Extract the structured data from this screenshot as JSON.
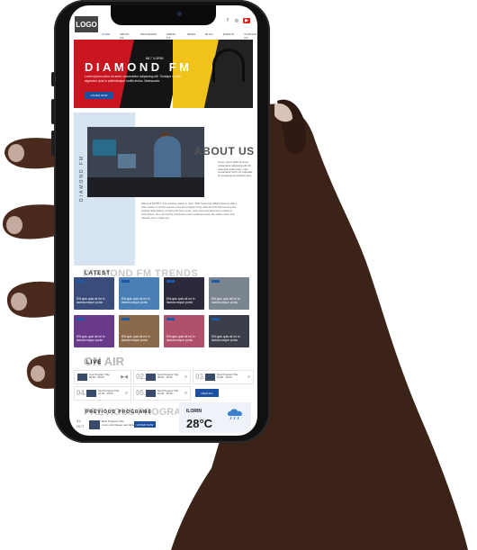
{
  "header": {
    "logo": "LOGO",
    "nav": [
      "HOME",
      "ABOUT US",
      "PROGRAMS",
      "PRESS KIT",
      "NEWS",
      "BLOG",
      "EVENTS",
      "CONTACT US"
    ],
    "socials": [
      "f",
      "◎",
      "▶"
    ]
  },
  "hero": {
    "tagline": "88.7 ILORIN",
    "title": "DIAMOND FM",
    "description": "Lorem ipsum dolor sit amet, consectetur adipiscing elit. Tristique in quis dignissim quis in pellentesque mollis lectus. Malesuada.",
    "button": "LISTEN NOW"
  },
  "about": {
    "vertical_label": "DIAMOND FM",
    "title": "ABOUT US",
    "aside": "Lorem ipsum dolor sit amet, consectetur adipiscing elit. Mi vitae quis dolor tortor, nulla consectetur tortor. Ac vulputate at consequat ac tincidunt arcu.",
    "paragraph": "Diamond FM 88.7 is an exciting station in Ilorin. With hosts that delight listeners with a wide variety of content across news and programming. Diamond FM has become the leading radio station, bringing the best music, news and entertainment to listeners everywhere. Our community, presenters and contributors keep the station fresh and relevant every single day."
  },
  "trends": {
    "heading_big": "DIAMOND FM TRENDS",
    "heading_small": "LATEST",
    "cards": [
      {
        "text": "Elit quis quis sit mi in lacinia neque porta",
        "color": "#3a4d7a"
      },
      {
        "text": "Elit quis quis sit mi in lacinia neque porta",
        "color": "#4a7fb5"
      },
      {
        "text": "Elit quis quis sit mi in lacinia neque porta",
        "color": "#2a2a3a"
      },
      {
        "text": "Elit quis quis sit mi in lacinia neque porta",
        "color": "#7a8590"
      },
      {
        "text": "Elit quis quis sit mi in lacinia neque porta",
        "color": "#6a3a8a"
      },
      {
        "text": "Elit quis quis sit mi in lacinia neque porta",
        "color": "#8a6a4a"
      },
      {
        "text": "Elit quis quis sit mi in lacinia neque porta",
        "color": "#b0506a"
      },
      {
        "text": "Elit quis quis sit mi in lacinia neque porta",
        "color": "#3a3f4a"
      }
    ]
  },
  "onair": {
    "heading_big": "ON AIR",
    "heading_small": "LIVE",
    "items": [
      {
        "num": "",
        "line1": "Live Program Title",
        "line2": "06:00 - 08:00"
      },
      {
        "num": "02.",
        "line1": "Next Program Title",
        "line2": "08:00 - 10:00"
      },
      {
        "num": "03.",
        "line1": "Next Program Title",
        "line2": "10:00 - 12:00"
      },
      {
        "num": "04.",
        "line1": "Next Program Title",
        "line2": "12:00 - 14:00"
      },
      {
        "num": "05.",
        "line1": "Next Program Title",
        "line2": "14:00 - 16:00"
      }
    ],
    "view_all": "VIEW ALL"
  },
  "previous": {
    "heading_big": "PREVIOUS PROGRAM",
    "heading_small": "PREVIOUS PROGRAMS",
    "day": "31,",
    "month": "OCT",
    "title": "Best Program Title",
    "sub": "Lorem dui integer sed dolor ipsum",
    "button": "LISTEN NOW"
  },
  "weather": {
    "city": "ILORIN",
    "temp": "28°C"
  }
}
